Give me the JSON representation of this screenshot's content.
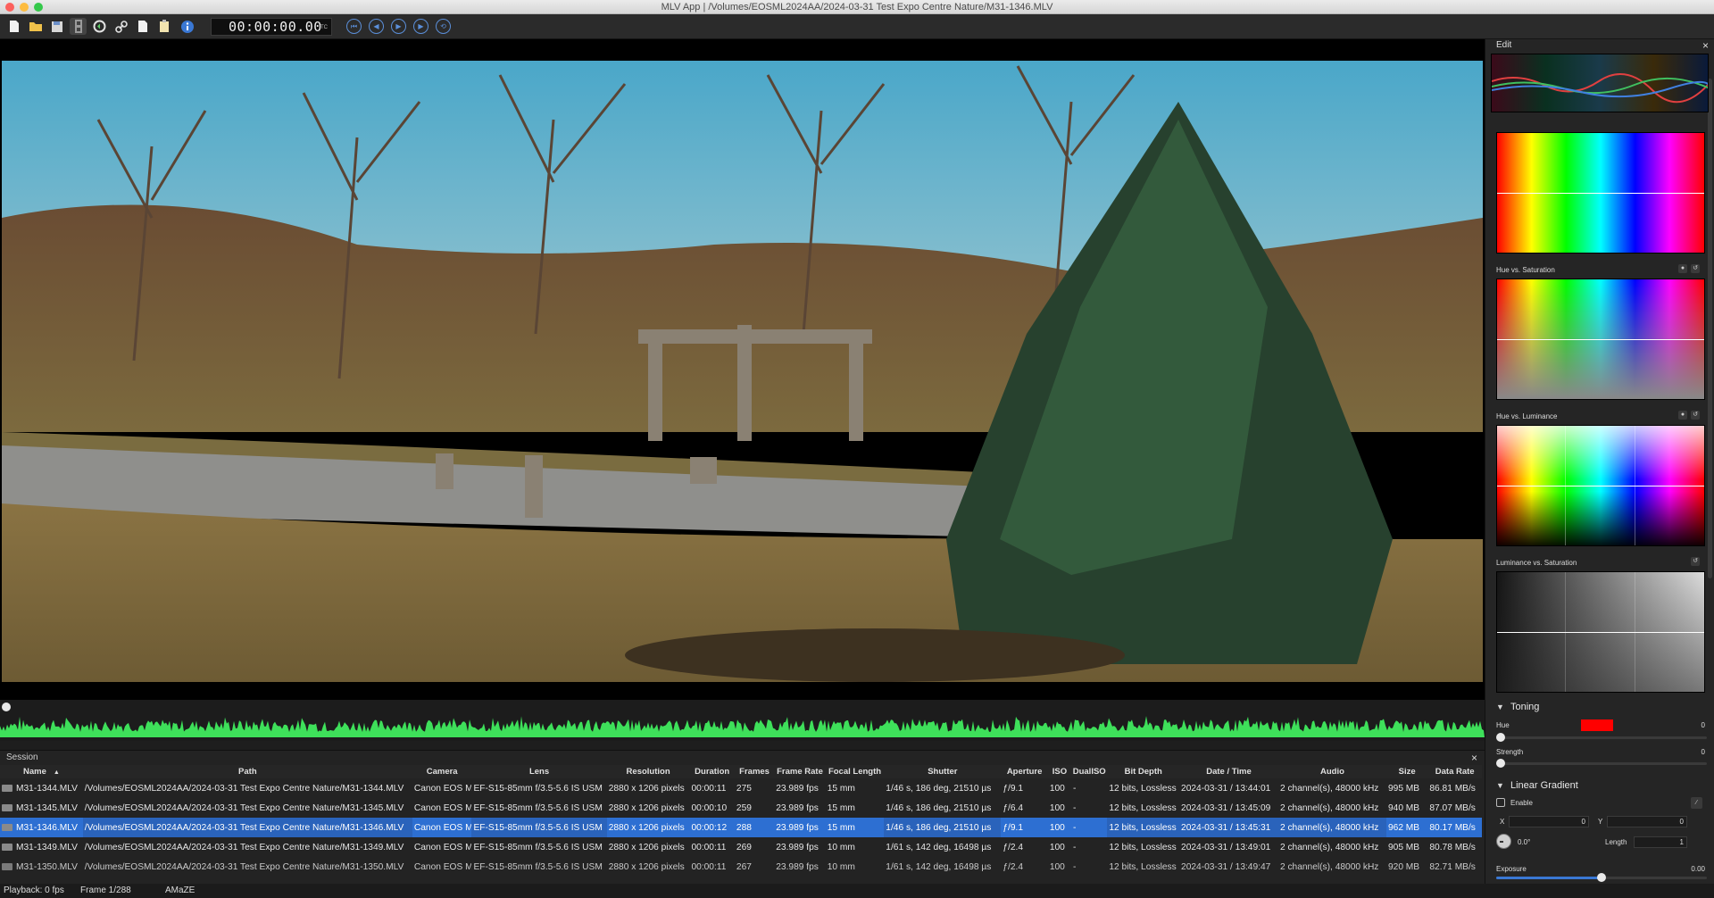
{
  "window": {
    "title": "MLV App | /Volumes/EOSML2024AA/2024-03-31 Test Expo Centre Nature/M31-1346.MLV"
  },
  "toolbar": {
    "timecode": "00:00:00.00",
    "timecode_label": "TC"
  },
  "session": {
    "title": "Session",
    "close_label": "×",
    "columns": [
      "Name",
      "Path",
      "Camera",
      "Lens",
      "Resolution",
      "Duration",
      "Frames",
      "Frame Rate",
      "Focal Length",
      "Shutter",
      "Aperture",
      "ISO",
      "DualISO",
      "Bit Depth",
      "Date / Time",
      "Audio",
      "Size",
      "Data Rate"
    ],
    "sort_indicator": "▲",
    "rows": [
      [
        "M31-1344.MLV",
        "/Volumes/EOSML2024AA/2024-03-31 Test Expo Centre Nature/M31-1344.MLV",
        "Canon EOS M",
        "EF-S15-85mm f/3.5-5.6 IS USM",
        "2880 x 1206 pixels",
        "00:00:11",
        "275",
        "23.989 fps",
        "15 mm",
        "1/46 s,  186 deg,  21510 µs",
        "ƒ/9.1",
        "100",
        "-",
        "12 bits,  Lossless",
        "2024-03-31 / 13:44:01",
        "2 channel(s),  48000 kHz",
        "995 MB",
        "86.81 MB/s"
      ],
      [
        "M31-1345.MLV",
        "/Volumes/EOSML2024AA/2024-03-31 Test Expo Centre Nature/M31-1345.MLV",
        "Canon EOS M",
        "EF-S15-85mm f/3.5-5.6 IS USM",
        "2880 x 1206 pixels",
        "00:00:10",
        "259",
        "23.989 fps",
        "15 mm",
        "1/46 s,  186 deg,  21510 µs",
        "ƒ/6.4",
        "100",
        "-",
        "12 bits,  Lossless",
        "2024-03-31 / 13:45:09",
        "2 channel(s),  48000 kHz",
        "940 MB",
        "87.07 MB/s"
      ],
      [
        "M31-1346.MLV",
        "/Volumes/EOSML2024AA/2024-03-31 Test Expo Centre Nature/M31-1346.MLV",
        "Canon EOS M",
        "EF-S15-85mm f/3.5-5.6 IS USM",
        "2880 x 1206 pixels",
        "00:00:12",
        "288",
        "23.989 fps",
        "15 mm",
        "1/46 s,  186 deg,  21510 µs",
        "ƒ/9.1",
        "100",
        "-",
        "12 bits,  Lossless",
        "2024-03-31 / 13:45:31",
        "2 channel(s),  48000 kHz",
        "962 MB",
        "80.17 MB/s"
      ],
      [
        "M31-1349.MLV",
        "/Volumes/EOSML2024AA/2024-03-31 Test Expo Centre Nature/M31-1349.MLV",
        "Canon EOS M",
        "EF-S15-85mm f/3.5-5.6 IS USM",
        "2880 x 1206 pixels",
        "00:00:11",
        "269",
        "23.989 fps",
        "10 mm",
        "1/61 s,  142 deg,  16498 µs",
        "ƒ/2.4",
        "100",
        "-",
        "12 bits,  Lossless",
        "2024-03-31 / 13:49:01",
        "2 channel(s),  48000 kHz",
        "905 MB",
        "80.78 MB/s"
      ],
      [
        "M31-1350.MLV",
        "/Volumes/EOSML2024AA/2024-03-31 Test Expo Centre Nature/M31-1350.MLV",
        "Canon EOS M",
        "EF-S15-85mm f/3.5-5.6 IS USM",
        "2880 x 1206 pixels",
        "00:00:11",
        "267",
        "23.989 fps",
        "10 mm",
        "1/61 s,  142 deg,  16498 µs",
        "ƒ/2.4",
        "100",
        "-",
        "12 bits,  Lossless",
        "2024-03-31 / 13:49:47",
        "2 channel(s),  48000 kHz",
        "920 MB",
        "82.71 MB/s"
      ]
    ],
    "selected_row": 2
  },
  "status": {
    "playback": "Playback: 0 fps",
    "frame": "Frame 1/288",
    "debayer": "AMaZE"
  },
  "edit": {
    "title": "Edit",
    "close_label": "×",
    "hue_vs_saturation": "Hue vs. Saturation",
    "hue_vs_luminance": "Hue vs. Luminance",
    "luminance_vs_saturation": "Luminance vs. Saturation",
    "toning": {
      "title": "Toning",
      "hue_label": "Hue",
      "hue_value": "0",
      "strength_label": "Strength",
      "strength_value": "0",
      "hue_color": "#ff0000"
    },
    "linear_gradient": {
      "title": "Linear Gradient",
      "enable_label": "Enable",
      "x_label": "X",
      "x_value": "0",
      "y_label": "Y",
      "y_value": "0",
      "angle_value": "0.0°",
      "length_label": "Length",
      "length_value": "1"
    },
    "exposure": {
      "label": "Exposure",
      "value": "0.00",
      "level": 0.5
    }
  },
  "colors": {
    "accent": "#2d6fd2",
    "waveform": "#3ee05a"
  }
}
